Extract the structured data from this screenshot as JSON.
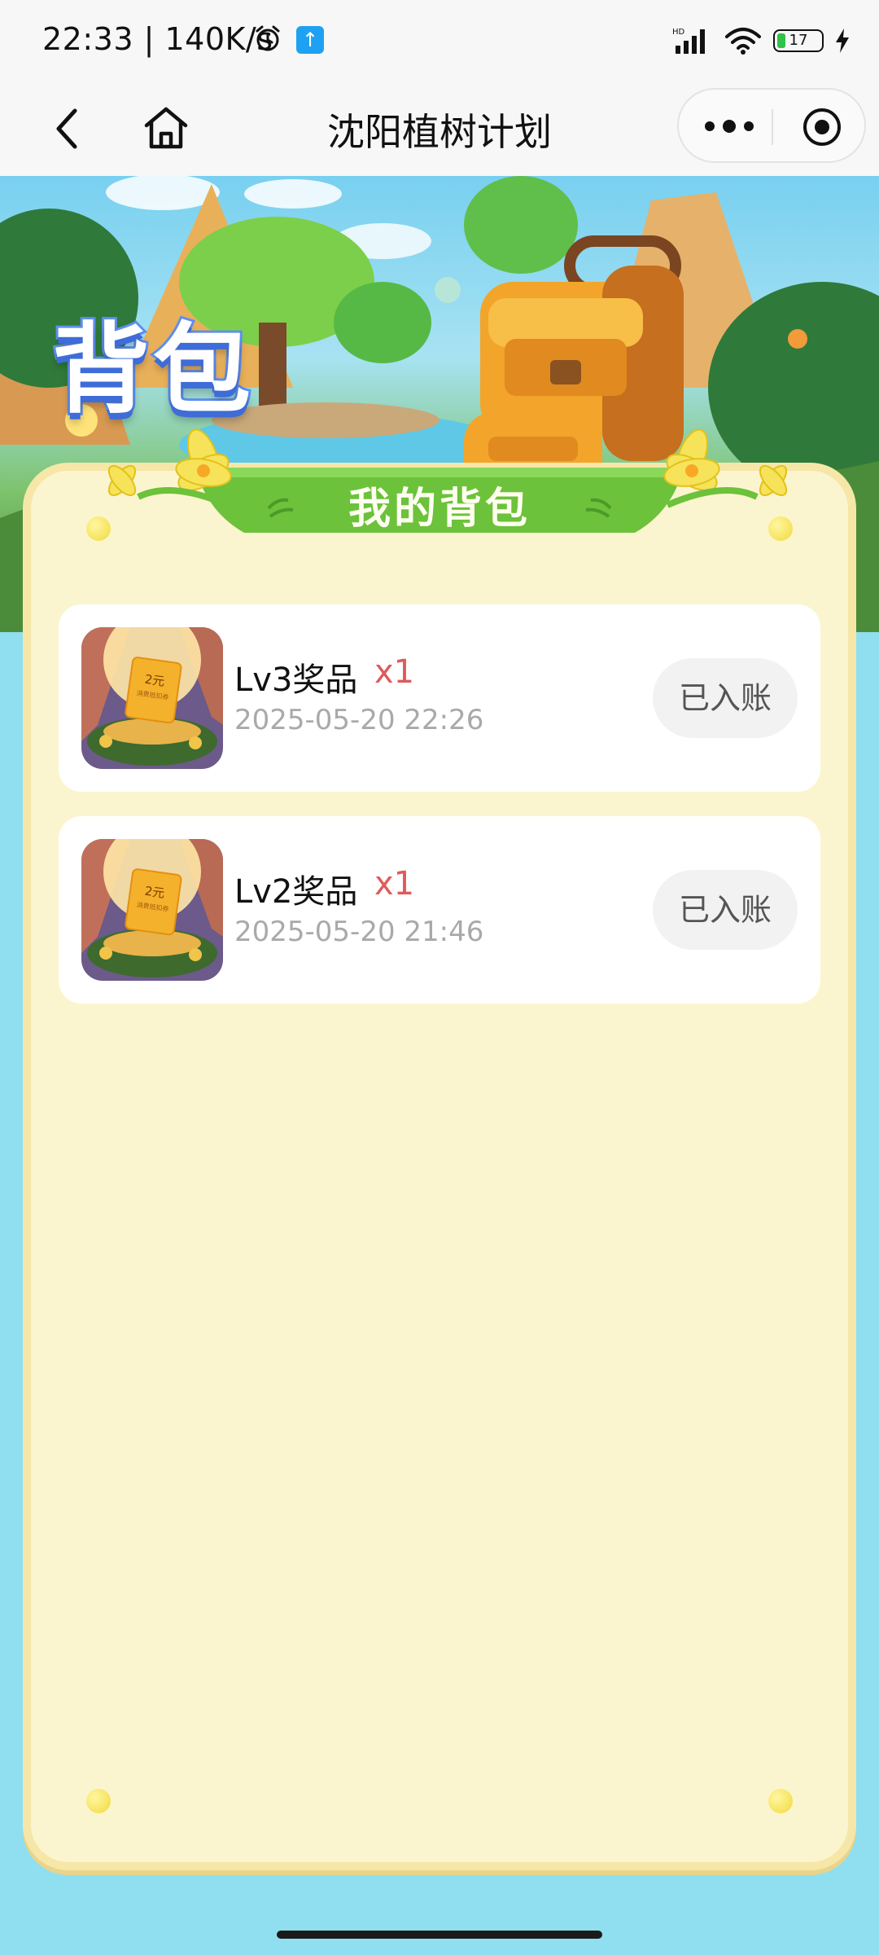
{
  "status_bar": {
    "time_speed": "22:33 | 140K/s",
    "network_label": "HD",
    "battery_level": "17"
  },
  "nav": {
    "title": "沈阳植树计划"
  },
  "hero": {
    "title": "背包"
  },
  "panel": {
    "banner_title": "我的背包"
  },
  "items": [
    {
      "name": "Lv3奖品",
      "qty": "x1",
      "time": "2025-05-20 22:26",
      "status": "已入账",
      "thumb_text_amount": "2元",
      "thumb_text_sub": "消费抵扣券"
    },
    {
      "name": "Lv2奖品",
      "qty": "x1",
      "time": "2025-05-20 21:46",
      "status": "已入账",
      "thumb_text_amount": "2元",
      "thumb_text_sub": "消费抵扣券"
    }
  ],
  "colors": {
    "accent_green": "#6cc23a",
    "qty_red": "#e05a5a",
    "panel_bg": "#fbf5cf",
    "page_bg": "#8fdff0"
  },
  "icons": {
    "status": [
      "alarm-icon",
      "upload-icon",
      "signal-icon",
      "wifi-icon",
      "battery-icon",
      "charging-icon"
    ],
    "nav": [
      "back-icon",
      "home-icon",
      "more-icon",
      "close-circle-icon"
    ]
  }
}
